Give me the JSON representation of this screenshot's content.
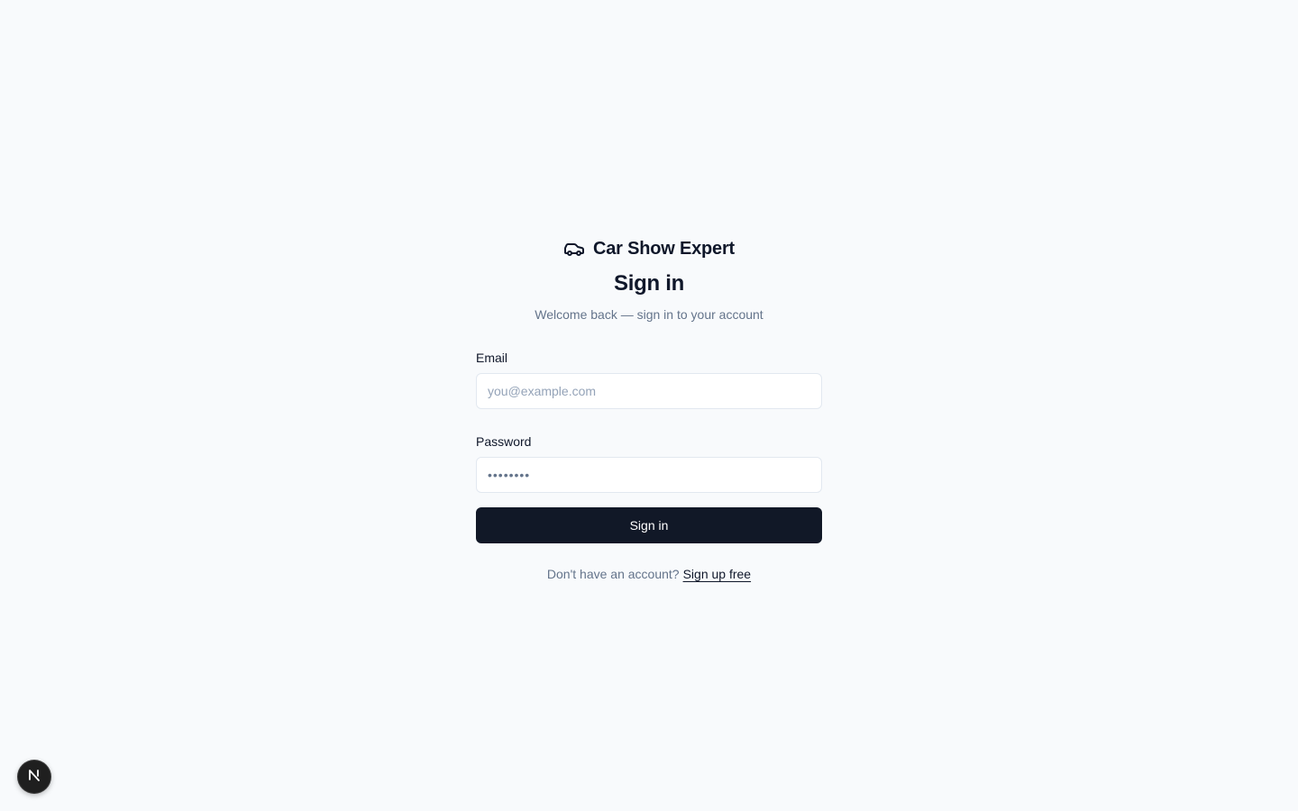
{
  "brand": {
    "icon": "car-icon",
    "name": "Car Show Expert"
  },
  "heading": {
    "title": "Sign in",
    "subtitle": "Welcome back — sign in to your account"
  },
  "form": {
    "email": {
      "label": "Email",
      "placeholder": "you@example.com",
      "value": ""
    },
    "password": {
      "label": "Password",
      "placeholder": "••••••••",
      "value": ""
    },
    "submit_label": "Sign in"
  },
  "footer": {
    "prompt": "Don't have an account?",
    "signup_label": "Sign up free"
  },
  "dev_badge": {
    "icon": "nextjs-icon",
    "letter": "N"
  },
  "colors": {
    "background": "#f8fafc",
    "primary_button": "#111827",
    "text": "#0f172a",
    "muted_text": "#64748b",
    "input_border": "#e2e8f0"
  }
}
